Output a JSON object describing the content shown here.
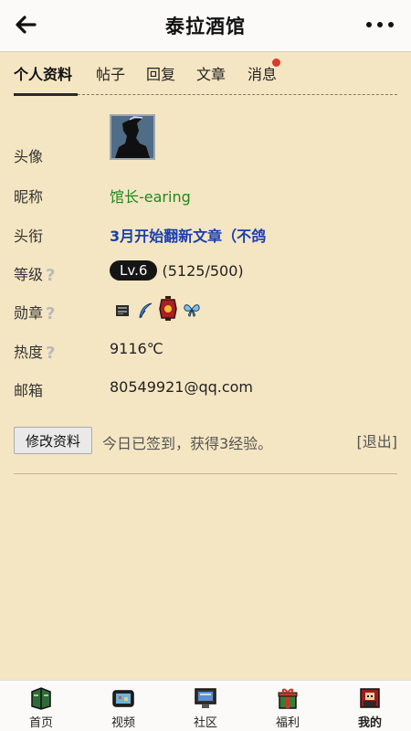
{
  "app": {
    "title": "泰拉酒馆"
  },
  "tabs": [
    {
      "label": "个人资料",
      "active": true
    },
    {
      "label": "帖子"
    },
    {
      "label": "回复"
    },
    {
      "label": "文章"
    },
    {
      "label": "消息",
      "has_badge": true
    }
  ],
  "profile": {
    "avatar_label": "头像",
    "nickname_label": "昵称",
    "nickname": "馆长-earing",
    "title_label": "头衔",
    "title": "3月开始翻新文章（不鸽",
    "level_label": "等级",
    "level": "Lv.6",
    "level_progress": "(5125/500)",
    "medals_label": "勋章",
    "medals": [
      "scroll-medal-icon",
      "feather-medal-icon",
      "lantern-medal-icon",
      "butterfly-medal-icon"
    ],
    "heat_label": "热度",
    "heat": "9116℃",
    "email_label": "邮箱",
    "email": "80549921@qq.com"
  },
  "actions": {
    "edit_label": "修改资料",
    "checkin_text": "今日已签到，获得3经验。",
    "logout_label": "[退出]"
  },
  "bottom_nav": [
    {
      "label": "首页",
      "icon": "book-icon"
    },
    {
      "label": "视频",
      "icon": "tv-icon"
    },
    {
      "label": "社区",
      "icon": "computer-icon"
    },
    {
      "label": "福利",
      "icon": "gift-icon"
    },
    {
      "label": "我的",
      "icon": "profile-icon",
      "active": true
    }
  ],
  "colors": {
    "background": "#f5e6c3",
    "nickname": "#1d8a1d",
    "title": "#1a3fae",
    "badge": "#d83a2c"
  }
}
